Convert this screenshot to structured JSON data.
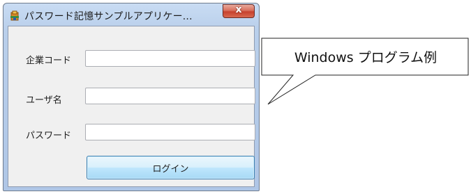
{
  "window": {
    "title": "パスワード記憶サンプルアプリケー...",
    "close_label": "x",
    "app_icon": "app-icon"
  },
  "form": {
    "company_code_label": "企業コード",
    "company_code_value": "",
    "username_label": "ユーザ名",
    "username_value": "",
    "password_label": "パスワード",
    "password_value": "",
    "login_label": "ログイン"
  },
  "callout": {
    "text": "Windows プログラム例"
  },
  "colors": {
    "window_frame": "#b9cfeb",
    "client_bg": "#f0f0f0",
    "close_button": "#c7412d",
    "login_button": "#bee6fd"
  }
}
